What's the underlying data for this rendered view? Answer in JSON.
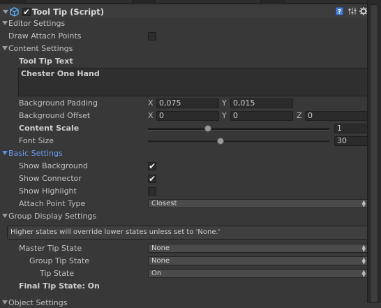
{
  "component": {
    "title": "Tool Tip (Script)",
    "enabled": true
  },
  "sections": {
    "editor": "Editor Settings",
    "content": "Content Settings",
    "basic": "Basic Settings",
    "group": "Group Display Settings",
    "object": "Object Settings"
  },
  "editor": {
    "draw_attach_points_label": "Draw Attach Points",
    "draw_attach_points": false
  },
  "content": {
    "tool_tip_text_label": "Tool Tip Text",
    "tool_tip_text": "Chester One Hand",
    "bg_padding_label": "Background Padding",
    "bg_padding": {
      "x_label": "X",
      "x": "0,075",
      "y_label": "Y",
      "y": "0,015"
    },
    "bg_offset_label": "Background Offset",
    "bg_offset": {
      "x_label": "X",
      "x": "0",
      "y_label": "Y",
      "y": "0",
      "z_label": "Z",
      "z": "0"
    },
    "content_scale_label": "Content Scale",
    "content_scale": "1",
    "content_scale_fraction": 0.33,
    "font_size_label": "Font Size",
    "font_size": "30",
    "font_size_fraction": 0.4
  },
  "basic": {
    "show_background_label": "Show Background",
    "show_background": true,
    "show_connector_label": "Show Connector",
    "show_connector": true,
    "show_highlight_label": "Show Highlight",
    "show_highlight": false,
    "attach_point_type_label": "Attach Point Type",
    "attach_point_type": "Closest"
  },
  "group": {
    "help_text": "Higher states will override lower states unless set to 'None.'",
    "master_tip_state_label": "Master Tip State",
    "master_tip_state": "None",
    "group_tip_state_label": "Group Tip State",
    "group_tip_state": "None",
    "tip_state_label": "Tip State",
    "tip_state": "On",
    "final_tip_state": "Final Tip State: On"
  },
  "icons": {
    "check_glyph": "✔",
    "popup_arrows": "▲▼"
  }
}
